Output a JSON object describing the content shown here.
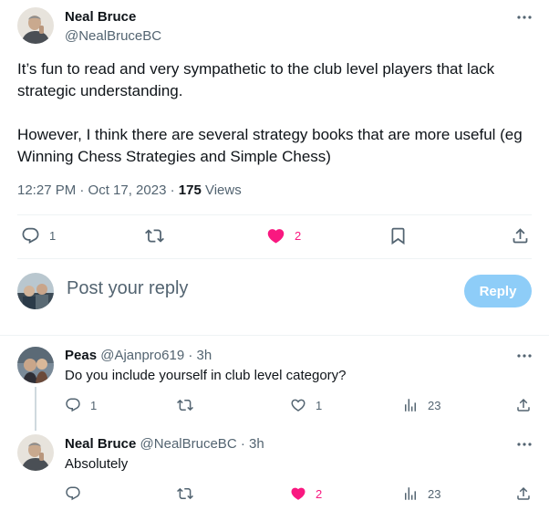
{
  "main_post": {
    "author_name": "Neal Bruce",
    "author_handle": "@NealBruceBC",
    "text_p1_line1": "It’s fun to read and very sympathetic to the club level players that lack",
    "text_p1_line2": "strategic understanding.",
    "text_p2_line1": "However, I think there are several strategy books that are more useful (eg",
    "text_p2_line2": "Winning Chess Strategies and Simple Chess)",
    "time": "12:27 PM · Oct 17, 2023 · ",
    "views_count": "175",
    "views_label": " Views",
    "actions": {
      "reply_count": "1",
      "repost_count": "",
      "like_count": "2",
      "liked": true
    }
  },
  "composer": {
    "placeholder": "Post your reply",
    "reply_button": "Reply"
  },
  "replies": [
    {
      "author_name": "Peas",
      "author_handle": "@Ajanpro619",
      "time": " · 3h",
      "text": "Do you include yourself in club level category?",
      "reply_count": "1",
      "like_count": "1",
      "views_count": "23",
      "liked": false
    },
    {
      "author_name": "Neal Bruce",
      "author_handle": "@NealBruceBC",
      "time": " · 3h",
      "text": "Absolutely",
      "reply_count": "",
      "like_count": "2",
      "views_count": "23",
      "liked": true
    }
  ],
  "colors": {
    "accent": "#1d9bf0",
    "like": "#f91880",
    "muted": "#536471",
    "divider": "#eff3f4",
    "reply_button_disabled": "#8ecdf8"
  },
  "icons": [
    "more-icon",
    "reply-icon",
    "repost-icon",
    "heart-icon",
    "bookmark-icon",
    "share-icon",
    "views-icon"
  ]
}
